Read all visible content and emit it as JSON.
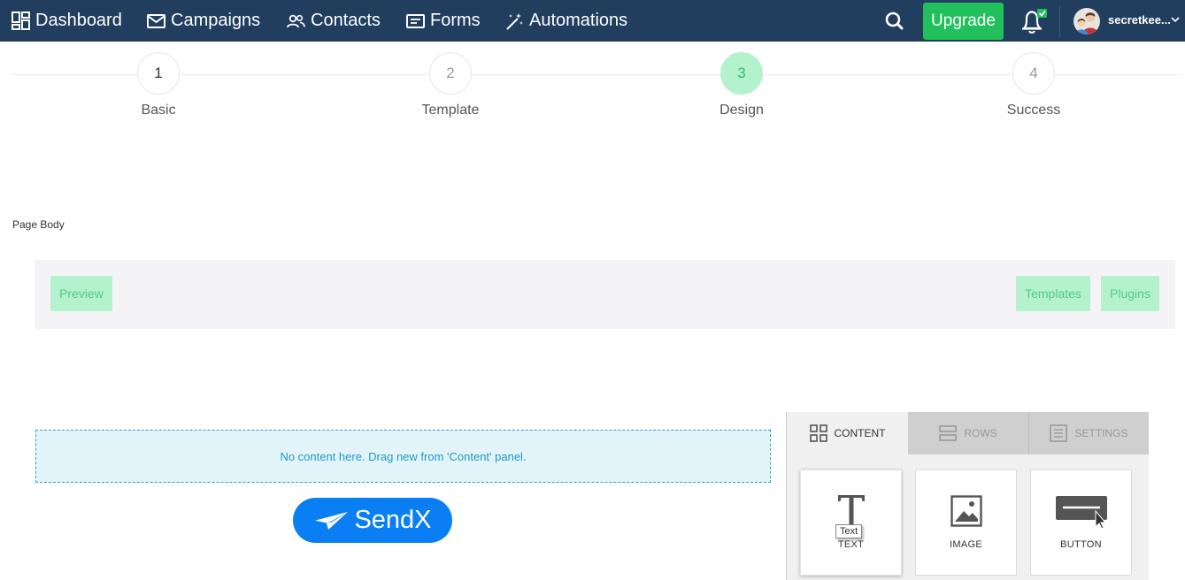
{
  "nav": {
    "items": [
      {
        "label": "Dashboard",
        "icon": "dashboard-icon"
      },
      {
        "label": "Campaigns",
        "icon": "envelope-icon"
      },
      {
        "label": "Contacts",
        "icon": "contacts-icon"
      },
      {
        "label": "Forms",
        "icon": "form-icon"
      },
      {
        "label": "Automations",
        "icon": "magic-wand-icon"
      }
    ],
    "upgrade_label": "Upgrade",
    "username": "secretkee...",
    "colors": {
      "bar": "#213e5f",
      "upgrade": "#22c05c",
      "notification_badge": "#22c05c"
    }
  },
  "stepper": {
    "steps": [
      {
        "number": "1",
        "label": "Basic",
        "state": "done"
      },
      {
        "number": "2",
        "label": "Template",
        "state": "pending"
      },
      {
        "number": "3",
        "label": "Design",
        "state": "active"
      },
      {
        "number": "4",
        "label": "Success",
        "state": "pending"
      }
    ],
    "active_color": "#b3f2cd"
  },
  "page_body_label": "Page Body",
  "toolbar": {
    "preview_label": "Preview",
    "templates_label": "Templates",
    "plugins_label": "Plugins"
  },
  "canvas": {
    "dropzone_text": "No content here. Drag new from 'Content' panel.",
    "logo_text": "SendX",
    "logo_color": "#0a7ff3"
  },
  "panel": {
    "tabs": [
      {
        "label": "CONTENT",
        "icon": "grid-icon",
        "active": true
      },
      {
        "label": "ROWS",
        "icon": "rows-icon",
        "active": false
      },
      {
        "label": "SETTINGS",
        "icon": "settings-list-icon",
        "active": false
      }
    ],
    "blocks": [
      {
        "label": "TEXT",
        "icon": "text-icon"
      },
      {
        "label": "IMAGE",
        "icon": "image-icon"
      },
      {
        "label": "BUTTON",
        "icon": "button-icon"
      }
    ],
    "tooltip": "Text"
  }
}
